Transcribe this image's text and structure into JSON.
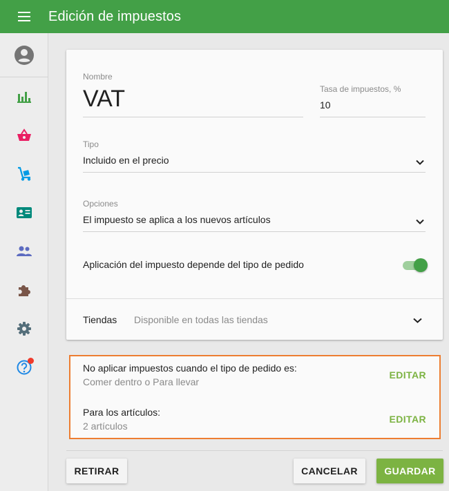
{
  "topbar": {
    "title": "Edición de impuestos"
  },
  "colors": {
    "primary": "#43a047",
    "accent_link": "#7cb342",
    "highlight_border": "#ed7d31"
  },
  "sidebar": {
    "items": [
      {
        "name": "account",
        "icon": "account-circle-icon",
        "color": "#757575"
      },
      {
        "name": "reports",
        "icon": "bar-chart-icon",
        "color": "#43a047"
      },
      {
        "name": "sales",
        "icon": "basket-icon",
        "color": "#e91e63"
      },
      {
        "name": "inventory",
        "icon": "hand-truck-icon",
        "color": "#039be5"
      },
      {
        "name": "employees",
        "icon": "id-card-icon",
        "color": "#00897b"
      },
      {
        "name": "customers",
        "icon": "people-icon",
        "color": "#5c6bc0"
      },
      {
        "name": "integrations",
        "icon": "puzzle-icon",
        "color": "#795548"
      },
      {
        "name": "settings",
        "icon": "gear-icon",
        "color": "#546e7a"
      },
      {
        "name": "help",
        "icon": "help-circle-icon",
        "color": "#1e88e5",
        "badge": true
      }
    ]
  },
  "form": {
    "name_label": "Nombre",
    "name_value": "VAT",
    "rate_label": "Tasa de impuestos, %",
    "rate_value": "10",
    "type_label": "Tipo",
    "type_value": "Incluido en el precio",
    "options_label": "Opciones",
    "options_value": "El impuesto se aplica a los nuevos artículos",
    "toggle_label": "Aplicación del impuesto depende del tipo de pedido",
    "toggle_on": true,
    "stores_label": "Tiendas",
    "stores_value": "Disponible en todas las tiendas"
  },
  "rules": {
    "order_type_title": "No aplicar impuestos cuando el tipo de pedido es:",
    "order_type_value": "Comer dentro o Para llevar",
    "items_title": "Para los artículos:",
    "items_value": "2 artículos",
    "edit_label": "EDITAR"
  },
  "footer": {
    "delete_label": "RETIRAR",
    "cancel_label": "CANCELAR",
    "save_label": "GUARDAR"
  }
}
